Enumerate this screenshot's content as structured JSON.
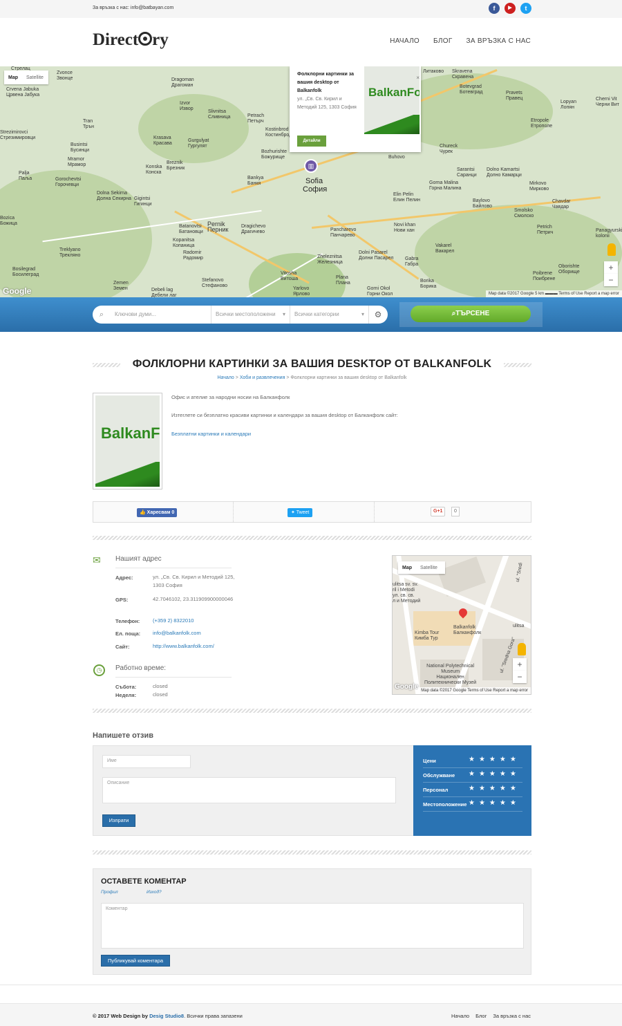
{
  "topbar": {
    "contact": "За връзка с нас: info@batbayan.com",
    "social": [
      {
        "icon": "facebook-icon",
        "glyph": "f",
        "color": "#3b5998"
      },
      {
        "icon": "youtube-icon",
        "glyph": "▶",
        "color": "#cd201f"
      },
      {
        "icon": "twitter-icon",
        "glyph": "t",
        "color": "#1da1f2"
      }
    ]
  },
  "header": {
    "logo_left": "Direct",
    "logo_right": "ry",
    "nav": [
      "НАЧАЛО",
      "БЛОГ",
      "ЗА ВРЪЗКА С НАС"
    ]
  },
  "map": {
    "type_map": "Map",
    "type_satellite": "Satellite",
    "google": "Google",
    "footer": "Map data ©2017 Google   5 km ▬▬▬   Terms of Use   Report a map error",
    "zoom_in": "+",
    "zoom_out": "−",
    "cities": [
      "Стрелац",
      "Zvonce\nЗвонце",
      "Crvena Jabuka\nЦрвена Јабука",
      "Dragoman\nДрагоман",
      "Izvor\nИзвор",
      "Slivnitsa\nСливница",
      "Petrach\nПетърч",
      "Kostinbrod\nКостинброд",
      "Bozhurishte\nБожурище",
      "Tran\nТрън",
      "Strezimirovci\nСтрезимировци",
      "Busintsi\nБусинци",
      "Mramor\nМрамор",
      "Krasava\nКрасава",
      "Gurgulyat\nГургулят",
      "Breznik\nБрезник",
      "Konska\nКонска",
      "Palja\nПаља",
      "Gorochevtsi\nГорочевци",
      "Dolna Sekirna\nДолна Секирна",
      "Gigintsi\nГигинци",
      "Bankya\nБанкя",
      "Pernik\nПерник",
      "Batanovtsi\nБатановци",
      "Kopanitsa\nКопаница",
      "Radomir\nРадомир",
      "Stefanovo\nСтефаново",
      "Dragichevo\nДрагичево",
      "Treklyano\nТрекляно",
      "Bosilegrad\nБосилеград",
      "Zemen\nЗемен",
      "Debeli lag\nДебели лаг",
      "Vitosha\nВитоша",
      "Zheleznitsa\nЖелезница",
      "Yarlovo\nЯрлово",
      "Plana\nПлана",
      "Pancharevo\nПанчарево",
      "Novi khan\nНови хан",
      "Dolni Pasarel\nДолни Пасарел",
      "Gabra\nГабра",
      "Gorni Okol\nГорни Окол",
      "Borika\nБорика",
      "Vakarel\nВакарел",
      "Elin Pelin\nЕлин Пелин",
      "Gorna Malina\nГорна Малина",
      "Baylovo\nБайлово",
      "Smolsko\nСмолско",
      "Petrich\nПетрич",
      "Sarantsi\nСаранци",
      "Dolno Kamartsi\nДолно Камарци",
      "Chureck\nЧурек",
      "Mirkovo\nМирково",
      "Chavdar\nЧавдар",
      "Etropole\nЕтрополе",
      "Pravets\nПравец",
      "Botevgrad\nБотевград",
      "Lopyan\nЛопян",
      "Cherni Vit\nЧерни Вит",
      "Литаково",
      "Skravena\nСкравена",
      "Buhovo",
      "Panagyurski\nkolonii",
      "Oborishte\nОборище",
      "Poibrene\nПоибрене",
      "Bozica\nБожица"
    ],
    "sofia_en": "Sofia",
    "sofia_bg": "София",
    "infowindow": {
      "title": "Фолклорни картинки за вашия desktop от Balkanfolk",
      "address": "ул. „Св. Св. Кирил и Методий 125, 1303 София",
      "button": "Детайли",
      "close": "×",
      "brand": "BalkanFo"
    }
  },
  "search": {
    "keywords_placeholder": "Ключови думи...",
    "location": "Всички местоположени",
    "category": "Всички категории",
    "button": "ТЪРСЕНЕ"
  },
  "listing": {
    "title": "ФОЛКЛОРНИ КАРТИНКИ ЗА ВАШИЯ DESKTOP ОТ BALKANFOLK",
    "breadcrumbs": [
      "Начало",
      "Хоби и развлечения",
      "Фолклорни картинки за вашия desktop от Balkanfolk"
    ],
    "image_brand": "BalkanF",
    "description": [
      "Офис и ателие за народни носии на Балканфолк",
      "Изтеглете си безплатно красиви картинки и календари за вашия desktop от Балканфолк сайт:"
    ],
    "link": "Безплатни картинки и календари"
  },
  "share": {
    "facebook": "Харесвам 0",
    "twitter": "Tweet",
    "gplus": "G+1",
    "gplus_count": "0"
  },
  "address": {
    "heading": "Нашият адрес",
    "rows": [
      {
        "label": "Адрес:",
        "value": "ул. „Св. Св. Кирил и Методий 125, 1303 София"
      },
      {
        "label": "GPS:",
        "value": "42.7046102, 23.311909900000046"
      },
      {
        "label": "Телефон:",
        "value": "(+359 2) 8322010"
      },
      {
        "label": "Ел. поща:",
        "value": "info@balkanfolk.com"
      },
      {
        "label": "Сайт:",
        "value": "http://www.balkanfolk.com/"
      }
    ]
  },
  "hours": {
    "heading": "Работно време:",
    "rows": [
      {
        "label": "Събота:",
        "value": "closed"
      },
      {
        "label": "Неделя:",
        "value": "closed"
      }
    ]
  },
  "minimap": {
    "type_map": "Map",
    "type_satellite": "Satellite",
    "labels": [
      "Balkanfolk\nБалканфолк",
      "Kimba Tour\nКимба Тур",
      "National Polytechnical\nMuseum\nНационален\nПолитехнически Музей",
      "ulitsa sv. sv.\nril i Metodi\nул. св. св.\nл и Методий",
      "ulitsa",
      "ul. \"Sredna Gora\"",
      "ul. \"Sredi"
    ],
    "footer": "Map data ©2017 Google   Terms of Use   Report a map error",
    "google": "Google"
  },
  "review": {
    "title": "Напишете отзив",
    "name_placeholder": "Име",
    "desc_placeholder": "Описание",
    "submit": "Изпрати",
    "criteria": [
      "Цени",
      "Обслужване",
      "Персонал",
      "Местоположение"
    ],
    "stars": "★★★★★"
  },
  "comment": {
    "title": "ОСТАВЕТЕ КОМЕНТАР",
    "profile": "Профил",
    "logout": "Изход?",
    "placeholder": "Коментар",
    "submit": "Публикувай коментара"
  },
  "footer": {
    "copy_prefix": "© 2017 Web Design by",
    "studio": "Desig Studio8",
    "copy_suffix": ". Всички права запазени",
    "nav": [
      "Начало",
      "Блог",
      "За връзка с нас"
    ]
  },
  "colors": {
    "accent_blue": "#2a73b3",
    "accent_green": "#6aa03c",
    "map_land": "#d9e4cc"
  }
}
